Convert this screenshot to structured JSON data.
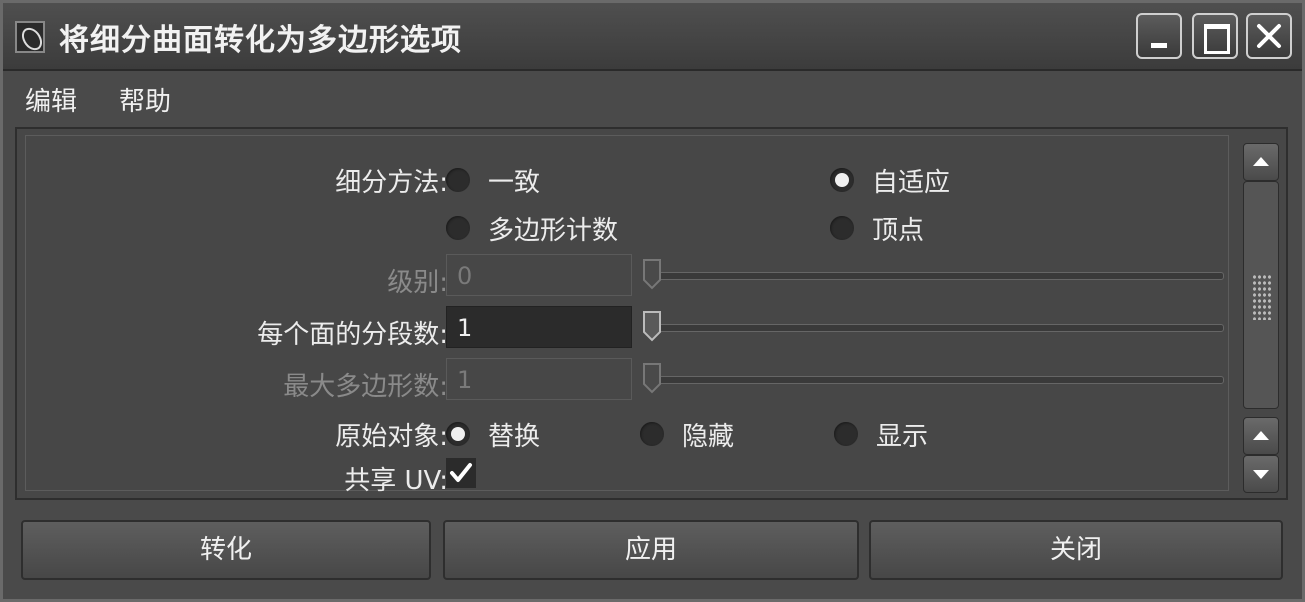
{
  "window": {
    "title": "将细分曲面转化为多边形选项",
    "controls": [
      "minimize",
      "maximize",
      "close"
    ]
  },
  "menu": {
    "items": [
      {
        "label": "编辑"
      },
      {
        "label": "帮助"
      }
    ]
  },
  "form": {
    "subdivision_method": {
      "label": "细分方法:",
      "options": [
        "一致",
        "自适应",
        "多边形计数",
        "顶点"
      ],
      "selected": "自适应"
    },
    "level": {
      "label": "级别:",
      "value": "0",
      "enabled": false,
      "slider_fraction": 0
    },
    "divisions_per_face": {
      "label": "每个面的分段数:",
      "value": "1",
      "enabled": true,
      "slider_fraction": 0
    },
    "max_polygons": {
      "label": "最大多边形数:",
      "value": "1",
      "enabled": false,
      "slider_fraction": 0
    },
    "original_object": {
      "label": "原始对象:",
      "options": [
        "替换",
        "隐藏",
        "显示"
      ],
      "selected": "替换"
    },
    "share_uvs": {
      "label": "共享 UV:",
      "checked": true
    }
  },
  "buttons": {
    "convert": "转化",
    "apply": "应用",
    "close": "关闭"
  },
  "icons": {
    "app": "maya-app-icon",
    "check": "checkmark-icon"
  },
  "colors": {
    "background": "#4a4a4a",
    "field_dark": "#2b2b2b",
    "text": "#ececec",
    "disabled_text": "#8a8a8a"
  }
}
